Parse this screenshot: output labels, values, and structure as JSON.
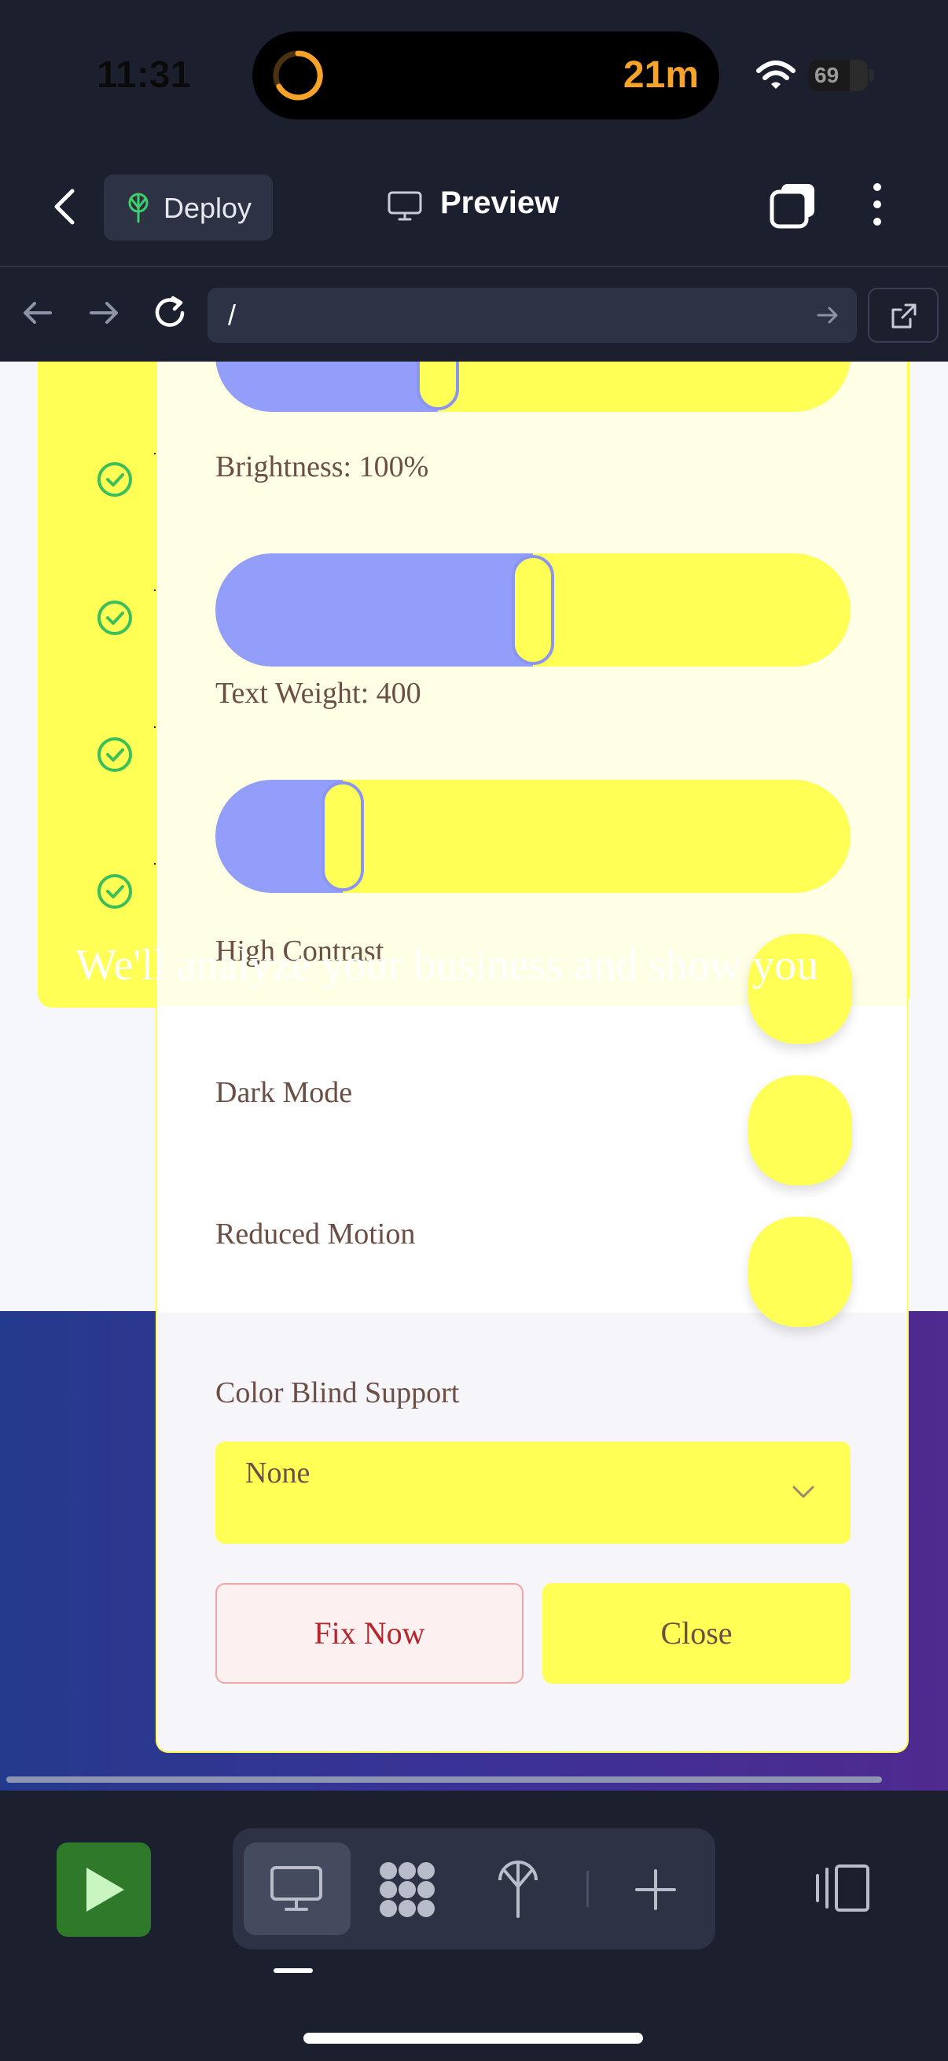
{
  "status_bar": {
    "time": "11:31",
    "timer": "21m",
    "battery": "69"
  },
  "toolbar": {
    "deploy_label": "Deploy",
    "title": "Preview"
  },
  "url_bar": {
    "url": "/"
  },
  "panel": {
    "sliders": [
      {
        "label": "",
        "value_fraction": 0.35
      },
      {
        "label": "Brightness: 100%",
        "value_fraction": 0.5
      },
      {
        "label": "Text Weight: 400",
        "value_fraction": 0.2
      }
    ],
    "toggles": [
      {
        "label": "High Contrast"
      },
      {
        "label": "Dark Mode"
      },
      {
        "label": "Reduced Motion"
      }
    ],
    "color_blind_label": "Color Blind Support",
    "color_blind_value": "None",
    "fix_now_label": "Fix Now",
    "close_label": "Close"
  },
  "hero": {
    "text": "We'll analyze your business and show you"
  },
  "colors": {
    "accent_yellow": "#ffff55",
    "slider_fill": "#939dfa",
    "text_brown": "#6b4f45",
    "danger_red": "#b3262b",
    "run_green": "#2f7a2a",
    "app_bg": "#1b1f2e"
  },
  "icons": [
    "wifi-icon",
    "timer-icon",
    "back-chevron-icon",
    "deploy-icon",
    "monitor-icon",
    "tabs-icon",
    "more-icon",
    "arrow-left-icon",
    "arrow-right-icon",
    "reload-icon",
    "open-external-icon",
    "check-circle-icon",
    "chevron-down-icon",
    "play-icon",
    "grid-icon",
    "antenna-icon",
    "plus-icon",
    "sidebar-panel-icon"
  ]
}
